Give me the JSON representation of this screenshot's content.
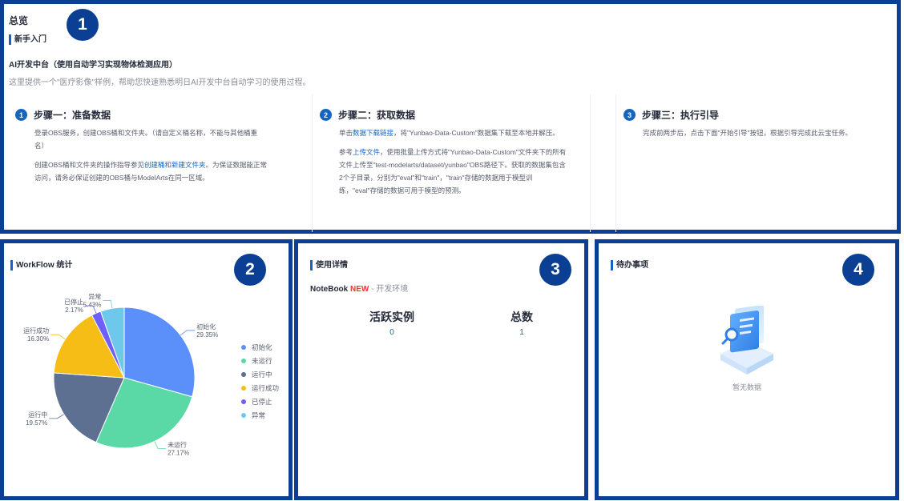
{
  "overview": {
    "badge": "1",
    "page_title": "总览",
    "section_title": "新手入门",
    "subtitle": "AI开发中台（使用自动学习实现物体检测应用）",
    "description": "这里提供一个\"医疗影像\"样例，帮助您快速熟悉明日AI开发中台自动学习的使用过程。",
    "steps": [
      {
        "num": "1",
        "title": "步骤一：准备数据",
        "p1": "登录OBS服务，创建OBS桶和文件夹。（请自定义桶名称，不能与其他桶重名）",
        "p2_pre": "创建OBS桶和文件夹的操作指导参见",
        "p2_link1": "创建桶",
        "p2_mid": "和",
        "p2_link2": "新建文件夹",
        "p2_post": "。为保证数据能正常访问，请务必保证创建的OBS桶与ModelArts在同一区域。"
      },
      {
        "num": "2",
        "title": "步骤二：获取数据",
        "p1_pre": "单击",
        "p1_link": "数据下载链接",
        "p1_post": "，将\"Yunbao-Data-Custom\"数据集下载至本地并解压。",
        "p2_pre": "参考",
        "p2_link": "上传文件",
        "p2_post": "，使用批量上传方式将\"Yunbao-Data-Custom\"文件夹下的所有文件上传至\"test-modelarts/dataset/yunbao\"OBS路径下。获取的数据集包含2个子目录，分别为\"eval\"和\"train\"，\"train\"存储的数据用于模型训练，\"eval\"存储的数据可用于模型的预测。"
      },
      {
        "num": "3",
        "title": "步骤三：执行引导",
        "p1": "完成前两步后，点击下面\"开始引导\"按钮，根据引导完成此云宝任务。"
      }
    ]
  },
  "workflow": {
    "badge": "2",
    "section_title": "WorkFlow 统计"
  },
  "chart_data": {
    "type": "pie",
    "slices": [
      {
        "name": "初始化",
        "value": 29.35,
        "label": "29.35%",
        "color": "#5b8ff9"
      },
      {
        "name": "未运行",
        "value": 27.17,
        "label": "27.17%",
        "color": "#5ad8a6"
      },
      {
        "name": "运行中",
        "value": 19.57,
        "label": "19.57%",
        "color": "#5d7092"
      },
      {
        "name": "运行成功",
        "value": 16.3,
        "label": "16.30%",
        "color": "#f6bd16"
      },
      {
        "name": "已停止",
        "value": 2.17,
        "label": "2.17%",
        "color": "#6f5ef9"
      },
      {
        "name": "异常",
        "value": 5.43,
        "label": "5.43%",
        "color": "#6dc8ec"
      }
    ],
    "legend_position": "right"
  },
  "usage": {
    "badge": "3",
    "section_title": "使用详情",
    "notebook_name": "NoteBook",
    "notebook_new": "NEW",
    "notebook_env": " - 开发环境",
    "active_label": "活跃实例",
    "active_value": "0",
    "total_label": "总数",
    "total_value": "1"
  },
  "todo": {
    "badge": "4",
    "section_title": "待办事项",
    "empty_text": "暂无数据",
    "empty_icon": "document-search-icon"
  }
}
